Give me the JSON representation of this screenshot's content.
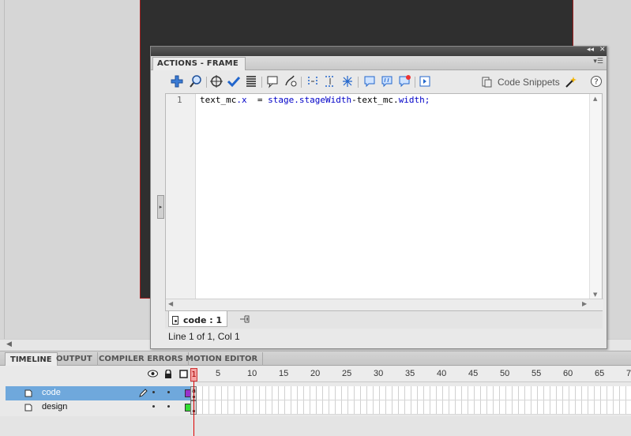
{
  "actions_panel": {
    "title": "ACTIONS - FRAME",
    "code_snippets_label": "Code Snippets",
    "line_number": "1",
    "code": {
      "part1": "text_mc",
      "part2": ".x",
      "part3": "  = ",
      "part4": "stage.stageWidth",
      "part5": "-text_mc.",
      "part6": "width;"
    },
    "script_tab_label": "code : 1",
    "status": "Line 1 of 1, Col 1",
    "toolbar_icons": [
      "add-statement-icon",
      "find-icon",
      "insert-target-path-icon",
      "check-syntax-icon",
      "auto-format-icon",
      "show-code-hint-icon",
      "debug-options-icon",
      "collapse-between-braces-icon",
      "collapse-selection-icon",
      "expand-all-icon",
      "apply-block-comment-icon",
      "apply-line-comment-icon",
      "remove-comment-icon",
      "show-hide-toolbox-icon"
    ]
  },
  "timeline": {
    "tabs": [
      "TIMELINE",
      "OUTPUT",
      "COMPILER ERRORS",
      "MOTION EDITOR"
    ],
    "active_tab": "TIMELINE",
    "playhead_frame": "1",
    "ruler": [
      "5",
      "10",
      "15",
      "20",
      "25",
      "30",
      "35",
      "40",
      "45",
      "50",
      "55",
      "60",
      "65",
      "7"
    ],
    "layers": [
      {
        "name": "code",
        "selected": true,
        "color": "#9933cc"
      },
      {
        "name": "design",
        "selected": false,
        "color": "#33dd33"
      }
    ]
  },
  "colors": {
    "stage": "#2f2f2f",
    "stage_border": "#a02020",
    "selection": "#6fa8dc",
    "playhead": "#dd0000",
    "code_blue": "#0000c8"
  }
}
